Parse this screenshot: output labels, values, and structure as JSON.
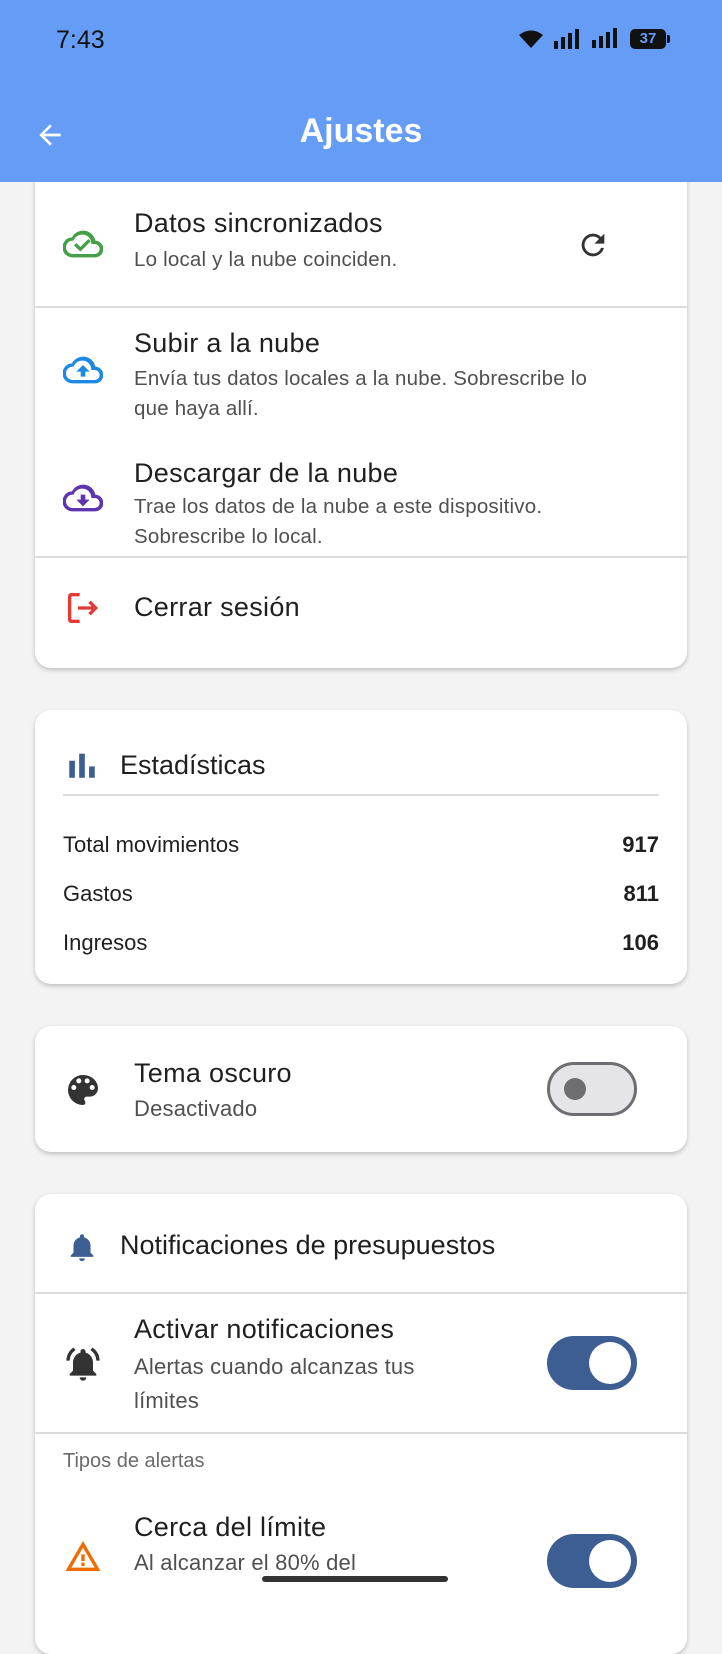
{
  "status_bar": {
    "time": "7:43",
    "battery": "37"
  },
  "app_bar": {
    "title": "Ajustes"
  },
  "sync_card": {
    "synced_title": "Datos sincronizados",
    "synced_subtitle": "Lo local y la nube coinciden.",
    "upload_title": "Subir a la nube",
    "upload_subtitle": "Envía tus datos locales a la nube. Sobrescribe lo que haya allí.",
    "download_title": "Descargar de la nube",
    "download_subtitle": "Trae los datos de la nube a este dispositivo. Sobrescribe lo local.",
    "logout_label": "Cerrar sesión"
  },
  "stats_card": {
    "title": "Estadísticas",
    "rows": [
      {
        "label": "Total movimientos",
        "value": "917"
      },
      {
        "label": "Gastos",
        "value": "811"
      },
      {
        "label": "Ingresos",
        "value": "106"
      }
    ]
  },
  "theme_card": {
    "title": "Tema oscuro",
    "subtitle": "Desactivado",
    "enabled": false
  },
  "notifications_card": {
    "title": "Notificaciones de presupuestos",
    "enable_title": "Activar notificaciones",
    "enable_subtitle": "Alertas cuando alcanzas tus límites",
    "enable_on": true,
    "alert_types_caption": "Tipos de alertas",
    "near_limit_title": "Cerca del límite",
    "near_limit_subtitle": "Al alcanzar el 80% del",
    "near_limit_on": true
  },
  "colors": {
    "app_bar": "#659cf5",
    "synced_icon": "#43a047",
    "upload_icon": "#1e88e5",
    "download_icon": "#5e35b1",
    "logout_icon": "#e53935",
    "accent": "#3d5e92",
    "warning_icon": "#ef6c00"
  }
}
